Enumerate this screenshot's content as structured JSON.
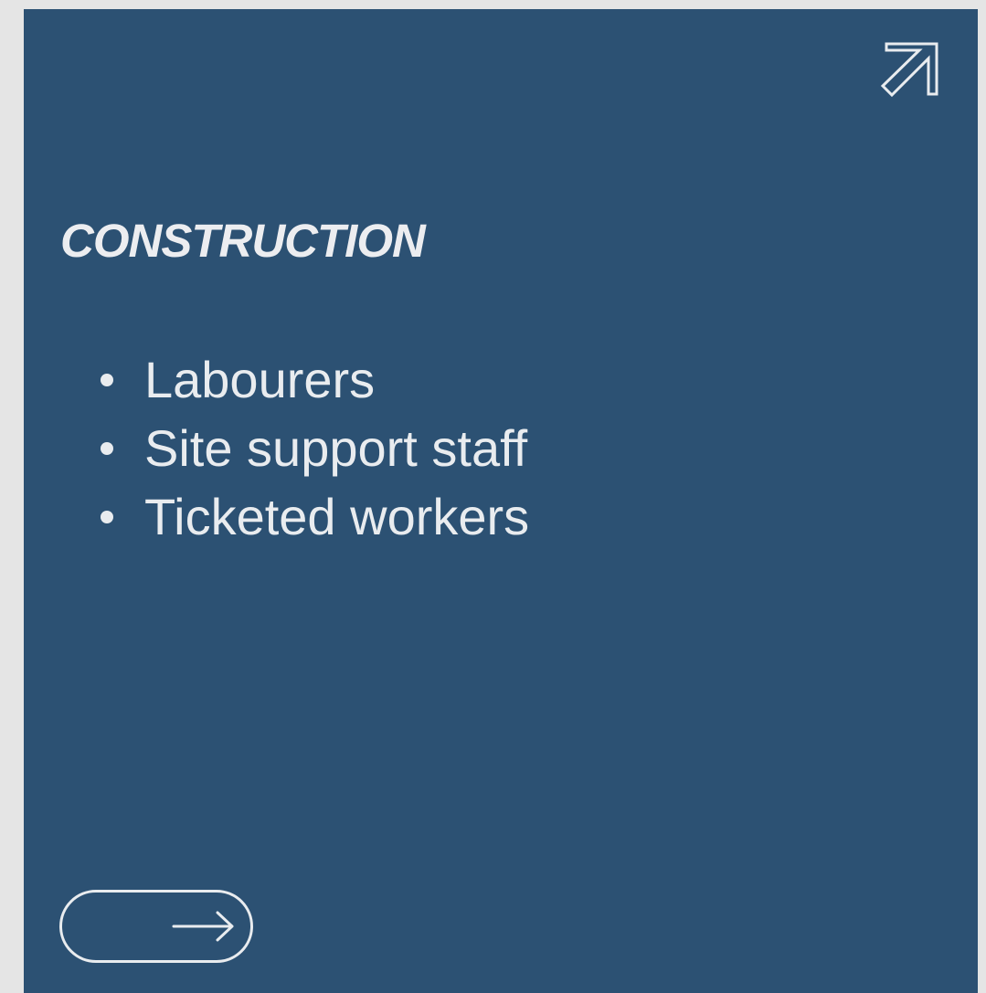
{
  "card": {
    "title": "CONSTRUCTION",
    "roles": [
      "Labourers",
      "Site support staff",
      "Ticketed workers"
    ],
    "corner_icon": "arrow-up-right-icon",
    "button_icon": "arrow-right-icon"
  },
  "colors": {
    "page_background": "#e5e5e5",
    "card_background": "#2c5173",
    "foreground": "#e9ecef"
  }
}
